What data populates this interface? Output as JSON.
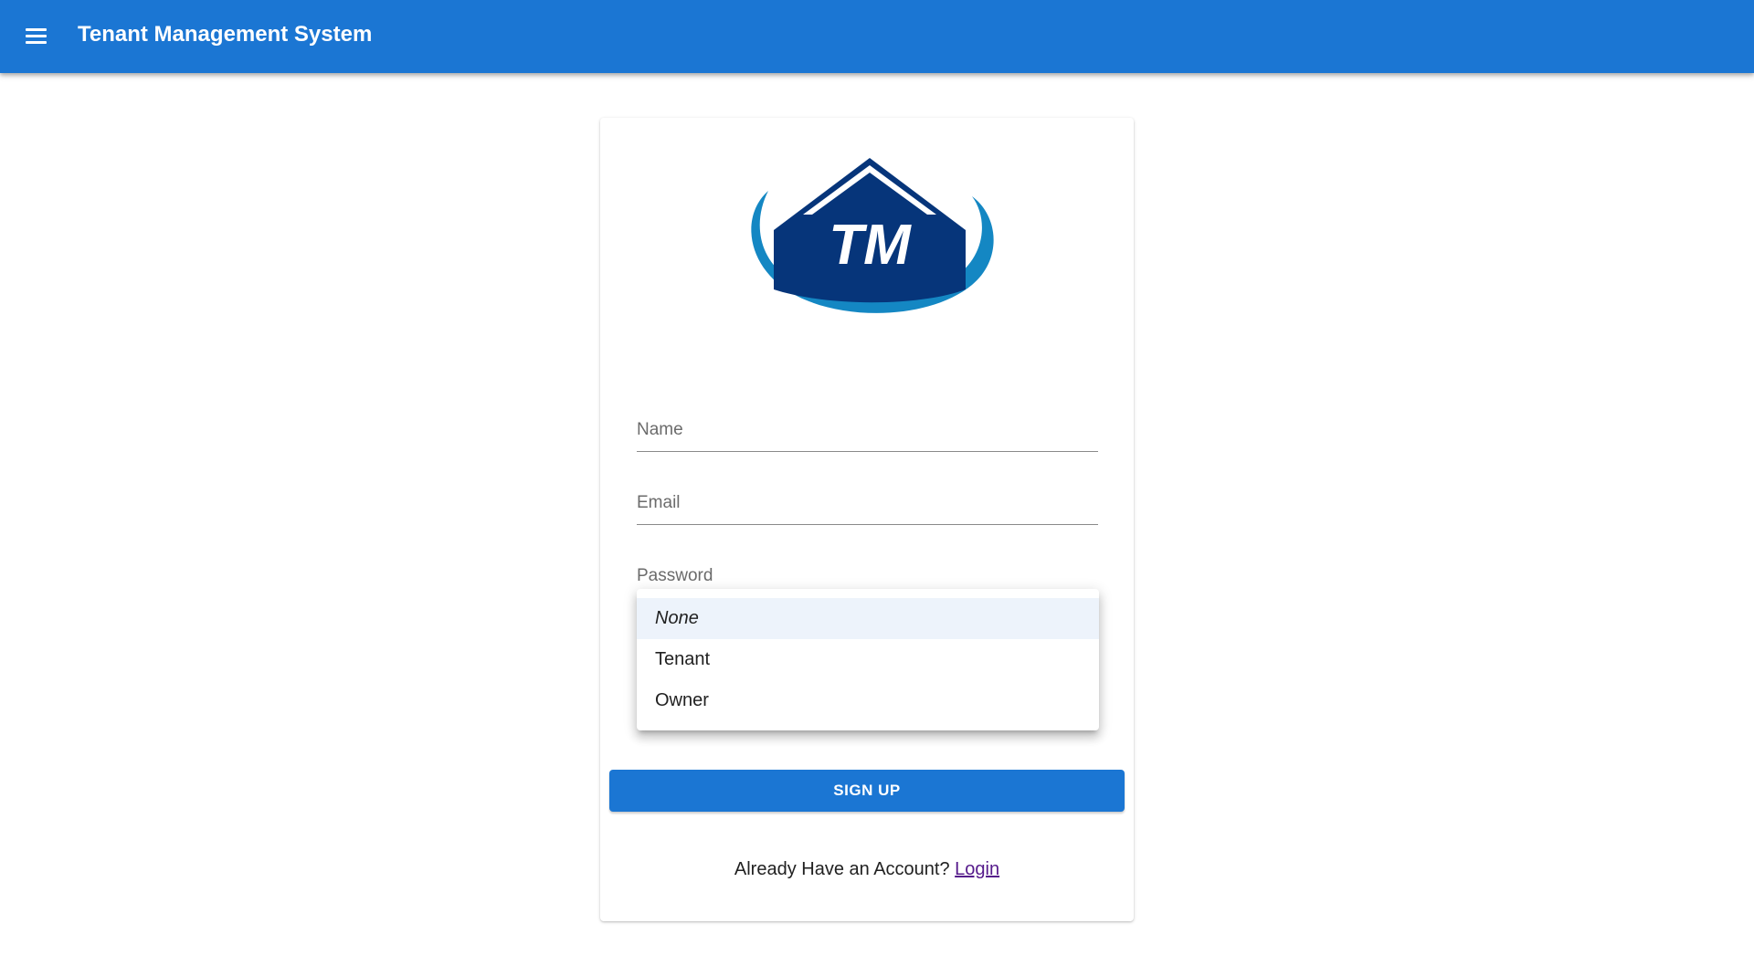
{
  "app": {
    "title": "Tenant Management System",
    "menu_icon": "menu-icon"
  },
  "colors": {
    "primary": "#1b76d3",
    "logo_dark": "#06357a",
    "logo_light": "#1487c3",
    "link_visited": "#551a8b"
  },
  "logo": {
    "text": "TM",
    "icon": "house-logo-icon"
  },
  "form": {
    "name_label": "Name",
    "email_label": "Email",
    "password_label": "Password",
    "role_options": [
      "None",
      "Tenant",
      "Owner"
    ],
    "role_selected": "None",
    "signup_label": "SIGN UP"
  },
  "footer": {
    "text": "Already Have an Account?",
    "login_link": "Login"
  }
}
